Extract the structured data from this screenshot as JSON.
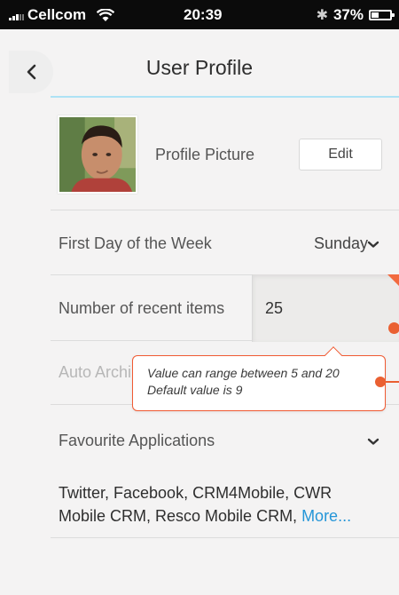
{
  "status_bar": {
    "carrier": "Cellcom",
    "time": "20:39",
    "battery": "37%"
  },
  "header": {
    "title": "User Profile"
  },
  "profile": {
    "label": "Profile Picture",
    "edit_label": "Edit"
  },
  "week": {
    "label": "First Day of the Week",
    "value": "Sunday"
  },
  "recent": {
    "label": "Number of recent items",
    "value": "25"
  },
  "archive": {
    "label": "Auto Archi"
  },
  "tooltip": {
    "line1": "Value can range between 5 and 20",
    "line2": "Default value is 9"
  },
  "favourites": {
    "label": "Favourite Applications",
    "list_text": "Twitter, Facebook, CRM4Mobile, CWR Mobile CRM, Resco Mobile CRM, ",
    "more_label": "More..."
  },
  "colors": {
    "accent": "#2596d8",
    "error": "#ea6032",
    "header_line": "#aee2f5"
  },
  "icons": [
    "signal-icon",
    "wifi-icon",
    "bluetooth-icon",
    "battery-icon",
    "back-chevron-icon",
    "chevron-down-icon",
    "error-marker-icon"
  ]
}
